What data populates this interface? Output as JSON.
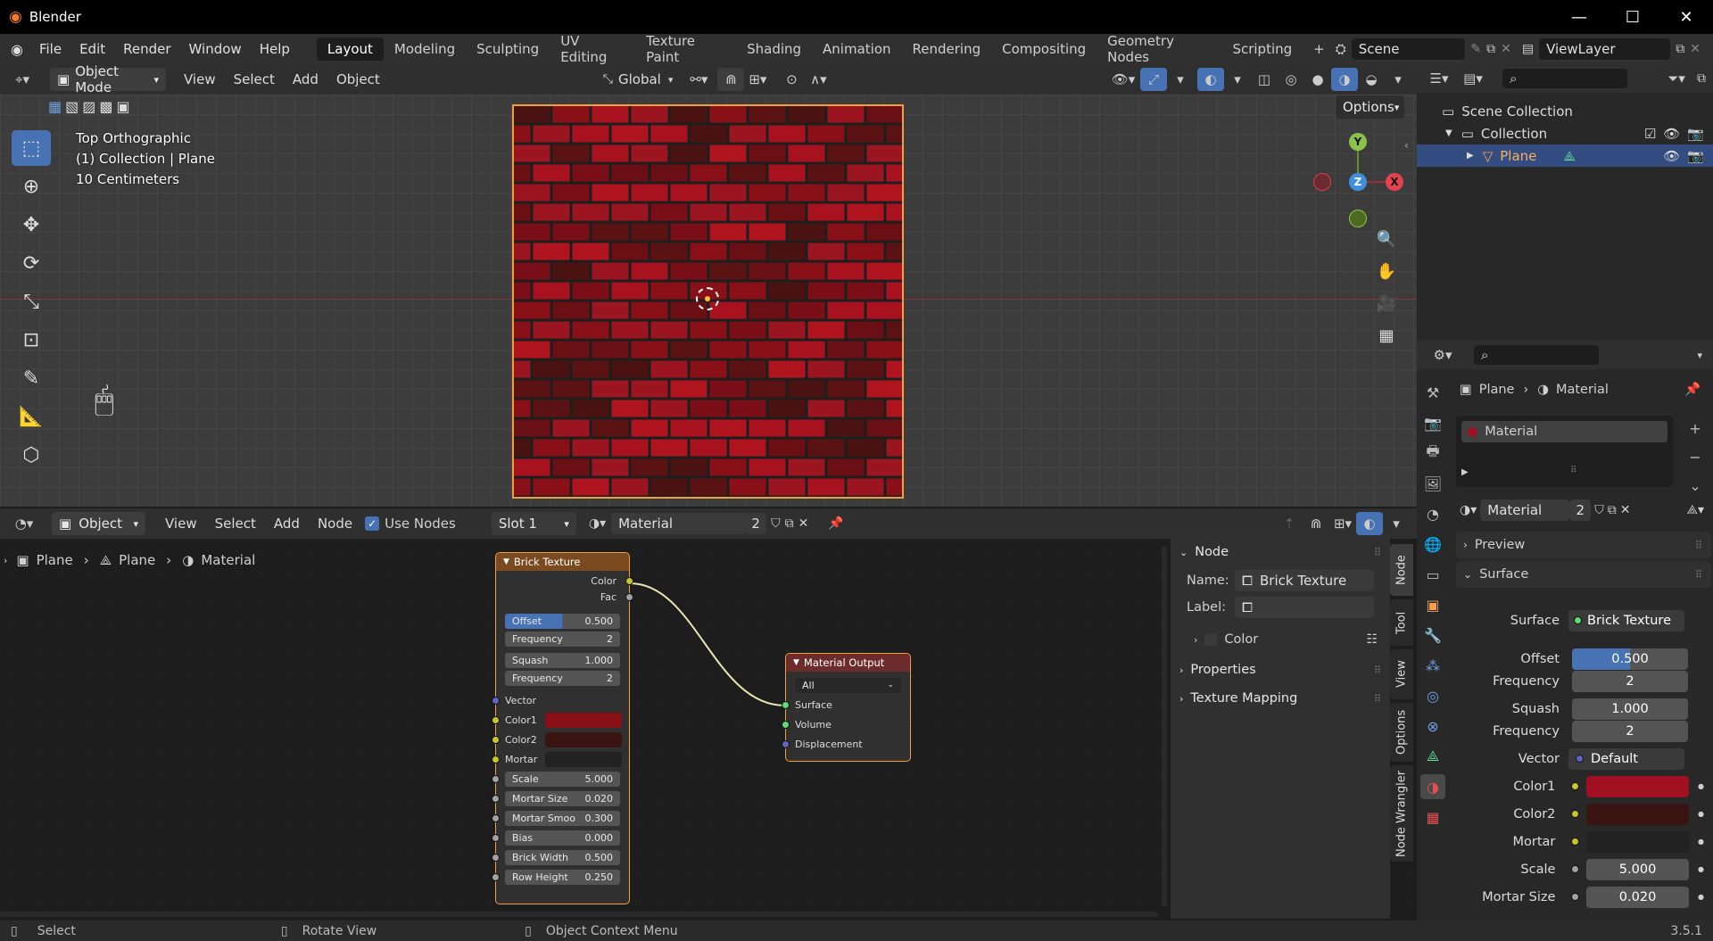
{
  "app": {
    "title": "Blender",
    "version": "3.5.1"
  },
  "menu": [
    "File",
    "Edit",
    "Render",
    "Window",
    "Help"
  ],
  "workspaces": [
    "Layout",
    "Modeling",
    "Sculpting",
    "UV Editing",
    "Texture Paint",
    "Shading",
    "Animation",
    "Rendering",
    "Compositing",
    "Geometry Nodes",
    "Scripting"
  ],
  "scene": "Scene",
  "view_layer": "ViewLayer",
  "viewport": {
    "mode": "Object Mode",
    "menus": [
      "View",
      "Select",
      "Add",
      "Object"
    ],
    "transform": "Global",
    "options": "Options",
    "overlay": [
      "Top Orthographic",
      "(1) Collection | Plane",
      "10 Centimeters"
    ],
    "gizmo": {
      "y": "Y",
      "z": "Z",
      "x": "X"
    }
  },
  "outliner": {
    "scene_collection": "Scene Collection",
    "collection": "Collection",
    "object": "Plane"
  },
  "node_editor": {
    "type": "Object",
    "menus": [
      "View",
      "Select",
      "Add",
      "Node"
    ],
    "use_nodes": "Use Nodes",
    "slot": "Slot 1",
    "material": "Material",
    "users": "2",
    "breadcrumb": [
      "Plane",
      "Plane",
      "Material"
    ]
  },
  "brick_node": {
    "title": "Brick Texture",
    "out_color": "Color",
    "out_fac": "Fac",
    "fields": [
      [
        "Offset",
        "0.500"
      ],
      [
        "Frequency",
        "2"
      ],
      [
        "Squash",
        "1.000"
      ],
      [
        "Frequency",
        "2"
      ]
    ],
    "vector": "Vector",
    "color1": "Color1",
    "color2": "Color2",
    "mortar": "Mortar",
    "values": [
      [
        "Scale",
        "5.000"
      ],
      [
        "Mortar Size",
        "0.020"
      ],
      [
        "Mortar Smoo",
        "0.300"
      ],
      [
        "Bias",
        "0.000"
      ],
      [
        "Brick Width",
        "0.500"
      ],
      [
        "Row Height",
        "0.250"
      ]
    ]
  },
  "output_node": {
    "title": "Material Output",
    "target": "All",
    "inputs": [
      "Surface",
      "Volume",
      "Displacement"
    ]
  },
  "side_panel": {
    "node": "Node",
    "name_label": "Name:",
    "name": "Brick Texture",
    "label_label": "Label:",
    "color": "Color",
    "properties": "Properties",
    "texture_mapping": "Texture Mapping",
    "tabs": [
      "Node",
      "Tool",
      "View",
      "Options",
      "Node Wrangler"
    ]
  },
  "properties": {
    "breadcrumb": [
      "Plane",
      "Material"
    ],
    "slot": "Material",
    "material": "Material",
    "users": "2",
    "preview": "Preview",
    "surface": "Surface",
    "rows": [
      [
        "Surface",
        "Brick Texture"
      ],
      [
        "Offset",
        "0.500"
      ],
      [
        "Frequency",
        "2"
      ],
      [
        "Squash",
        "1.000"
      ],
      [
        "Frequency",
        "2"
      ],
      [
        "Vector",
        "Default"
      ],
      [
        "Color1",
        ""
      ],
      [
        "Color2",
        ""
      ],
      [
        "Mortar",
        ""
      ],
      [
        "Scale",
        "5.000"
      ],
      [
        "Mortar Size",
        "0.020"
      ]
    ]
  },
  "status": {
    "select": "Select",
    "rotate": "Rotate View",
    "context": "Object Context Menu"
  },
  "colors": {
    "brick1": "#8a1018",
    "brick2": "#3a1410",
    "mortar": "#1e1e1e",
    "accent": "#4772b3",
    "node_header_texture": "#7b4a1f",
    "node_header_output": "#6e2b2b"
  }
}
